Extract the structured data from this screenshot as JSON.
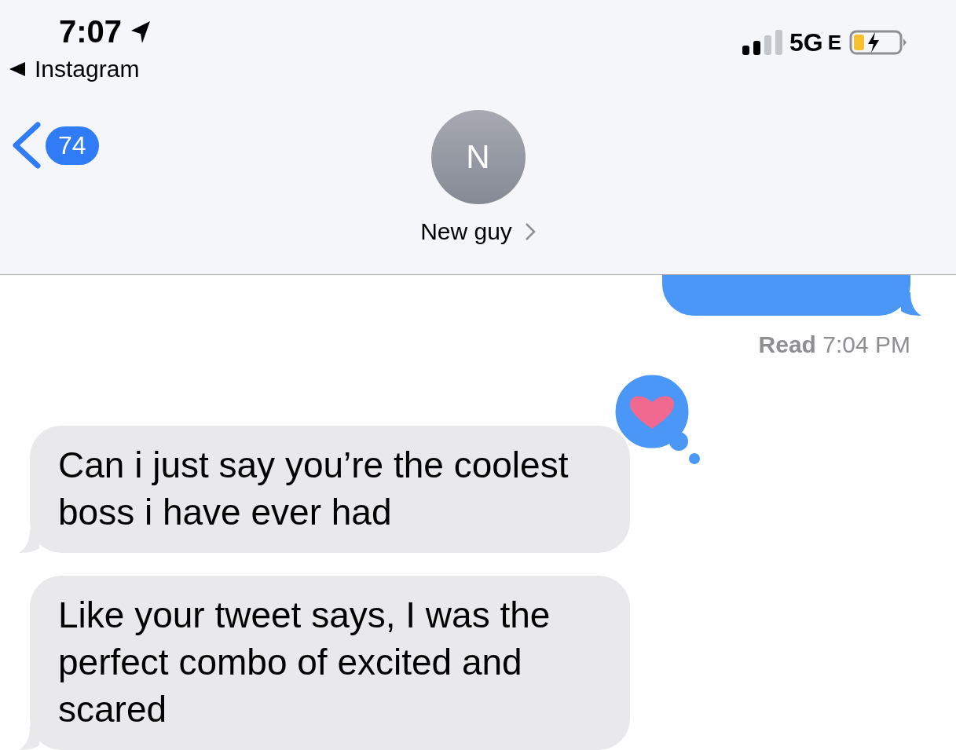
{
  "status_bar": {
    "time": "7:07",
    "back_app": "Instagram",
    "network": "5G",
    "network_suffix": "E",
    "charging": true
  },
  "nav": {
    "unread_count": "74",
    "avatar_initial": "N",
    "contact_name": "New guy"
  },
  "messages": [
    {
      "kind": "sent"
    },
    {
      "kind": "status",
      "text": "**Read** 7:04 PM"
    },
    {
      "kind": "received",
      "text": "Can i just say you’re the coolest boss i have ever had",
      "tapback": {
        "kind": "heart"
      }
    },
    {
      "kind": "received",
      "text": "Like your tweet says, I was the perfect combo of excited and scared"
    }
  ]
}
